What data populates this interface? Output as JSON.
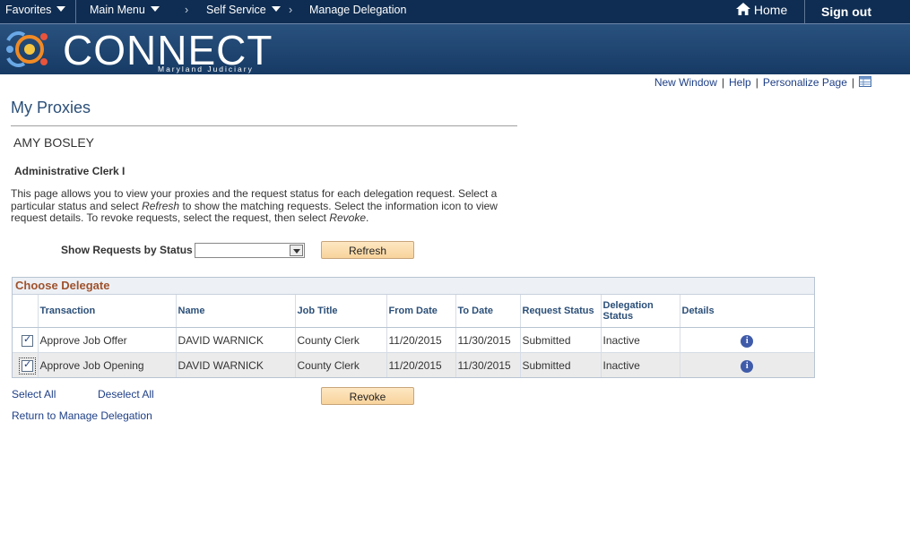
{
  "nav": {
    "favorites": "Favorites",
    "main_menu": "Main Menu",
    "self_service": "Self Service",
    "current": "Manage Delegation",
    "home": "Home",
    "sign_out": "Sign out"
  },
  "brand": {
    "name": "CONNECT",
    "subtitle": "Maryland Judiciary"
  },
  "page_links": {
    "new_window": "New Window",
    "help": "Help",
    "personalize": "Personalize Page"
  },
  "page": {
    "title": "My Proxies",
    "person_name": "AMY BOSLEY",
    "job_title": "Administrative Clerk I",
    "description_1": "This page allows you to view your proxies and the request status for each delegation request. Select a particular status and select ",
    "description_refresh": "Refresh",
    "description_2": " to show the matching requests. Select the information icon to view request details. To revoke requests, select the request, then select ",
    "description_revoke": "Revoke",
    "description_3": "."
  },
  "filter": {
    "label": "Show Requests by Status",
    "selected": "",
    "refresh_button": "Refresh"
  },
  "grid": {
    "title": "Choose Delegate",
    "columns": [
      "Transaction",
      "Name",
      "Job Title",
      "From Date",
      "To Date",
      "Request Status",
      "Delegation Status",
      "Details"
    ],
    "rows": [
      {
        "checked": true,
        "transaction": "Approve Job Offer",
        "name": "DAVID WARNICK",
        "job_title": "County Clerk",
        "from": "11/20/2015",
        "to": "11/30/2015",
        "request_status": "Submitted",
        "delegation_status": "Inactive"
      },
      {
        "checked": true,
        "transaction": "Approve Job Opening",
        "name": "DAVID WARNICK",
        "job_title": "County Clerk",
        "from": "11/20/2015",
        "to": "11/30/2015",
        "request_status": "Submitted",
        "delegation_status": "Inactive"
      }
    ]
  },
  "actions": {
    "select_all": "Select All",
    "deselect_all": "Deselect All",
    "revoke_button": "Revoke",
    "return_link": "Return to Manage Delegation"
  },
  "colors": {
    "nav_bg": "#0f2d52",
    "link": "#1e3f86",
    "grid_title": "#a0522d",
    "button": "#f8d39c"
  }
}
